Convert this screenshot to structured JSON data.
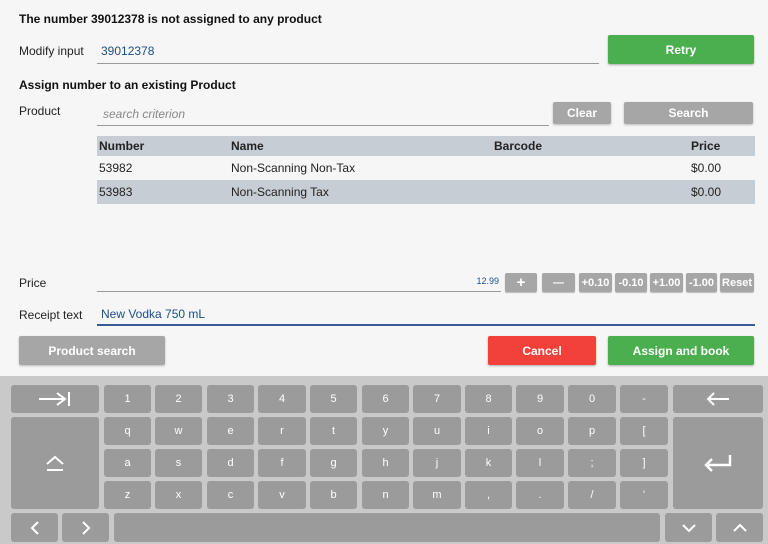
{
  "header": {
    "title": "The number 39012378 is not assigned to any product"
  },
  "modify": {
    "label": "Modify input",
    "value": "39012378",
    "retry_label": "Retry"
  },
  "assign": {
    "heading": "Assign number to an existing Product"
  },
  "product": {
    "label": "Product",
    "placeholder": "search criterion",
    "clear_label": "Clear",
    "search_label": "Search"
  },
  "table": {
    "columns": [
      "Number",
      "Name",
      "Barcode",
      "Price"
    ],
    "rows": [
      {
        "number": "53982",
        "name": "Non-Scanning Non-Tax",
        "barcode": "",
        "price": "$0.00"
      },
      {
        "number": "53983",
        "name": "Non-Scanning Tax",
        "barcode": "",
        "price": "$0.00"
      }
    ]
  },
  "price": {
    "label": "Price",
    "value": "12.99",
    "buttons": [
      "+",
      "—",
      "+0.10",
      "-0.10",
      "+1.00",
      "-1.00",
      "Reset"
    ]
  },
  "receipt": {
    "label": "Receipt text",
    "value": "New Vodka 750 mL"
  },
  "actions": {
    "product_search": "Product search",
    "cancel": "Cancel",
    "assign_book": "Assign and book"
  },
  "keyboard": {
    "row1": [
      "1",
      "2",
      "3",
      "4",
      "5",
      "6",
      "7",
      "8",
      "9",
      "0",
      "-"
    ],
    "row2": [
      "q",
      "w",
      "e",
      "r",
      "t",
      "y",
      "u",
      "i",
      "o",
      "p",
      "["
    ],
    "row3": [
      "a",
      "s",
      "d",
      "f",
      "g",
      "h",
      "j",
      "k",
      "l",
      ";",
      "]"
    ],
    "row4": [
      "z",
      "x",
      "c",
      "v",
      "b",
      "n",
      "m",
      ",",
      ".",
      "/",
      "'"
    ],
    "icons": [
      "tab-icon",
      "backspace-icon",
      "shift-icon",
      "enter-icon",
      "arrow-left-icon",
      "arrow-right-icon",
      "arrow-down-icon",
      "arrow-up-icon"
    ]
  },
  "colors": {
    "green": "#4bae4f",
    "red": "#f2403a",
    "gray_button": "#a6a6a6",
    "input_blue": "#1f4e86",
    "table_header": "#c6cdd4"
  }
}
